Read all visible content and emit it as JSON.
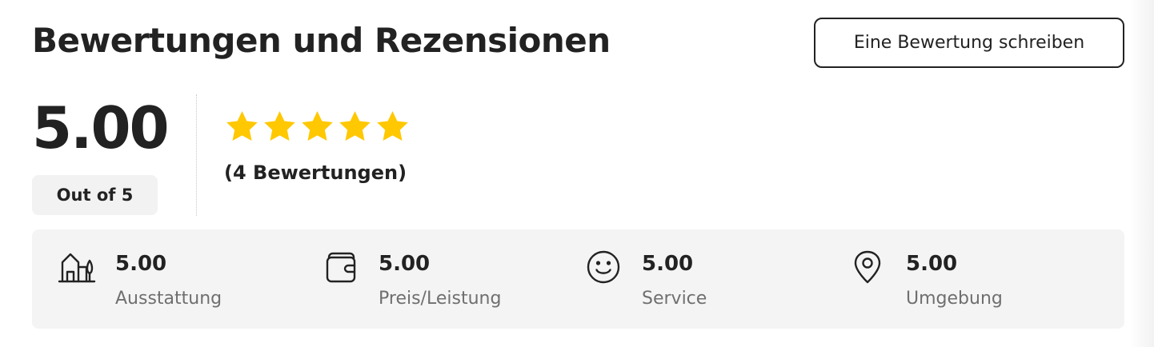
{
  "header": {
    "title": "Bewertungen und Rezensionen",
    "write_review_label": "Eine Bewertung schreiben"
  },
  "summary": {
    "score": "5.00",
    "out_of_label": "Out of 5",
    "stars_filled": 5,
    "stars_total": 5,
    "star_color": "#FFC800",
    "review_count_label": "(4 Bewertungen)"
  },
  "categories": [
    {
      "icon": "house-icon",
      "value": "5.00",
      "label": "Ausstattung"
    },
    {
      "icon": "wallet-icon",
      "value": "5.00",
      "label": "Preis/Leistung"
    },
    {
      "icon": "smiley-icon",
      "value": "5.00",
      "label": "Service"
    },
    {
      "icon": "location-pin-icon",
      "value": "5.00",
      "label": "Umgebung"
    }
  ]
}
